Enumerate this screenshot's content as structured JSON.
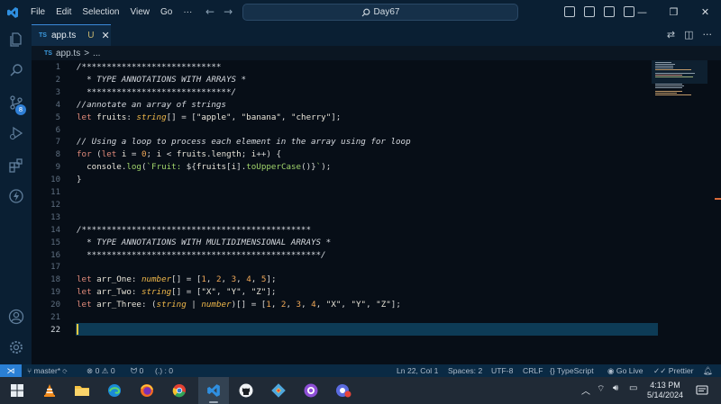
{
  "titlebar": {
    "menu": [
      "File",
      "Edit",
      "Selection",
      "View",
      "Go",
      "···"
    ],
    "search_text": "Day67"
  },
  "activity": {
    "scm_badge": "8"
  },
  "tab": {
    "lang": "TS",
    "name": "app.ts",
    "status": "U"
  },
  "breadcrumb": {
    "lang": "TS",
    "file": "app.ts",
    "sep": ">",
    "rest": "..."
  },
  "editor": {
    "active_line": 22,
    "lines": [
      [
        [
          "c-com",
          "/****************************"
        ]
      ],
      [
        [
          "c-com",
          "  * TYPE ANNOTATIONS WITH ARRAYS *"
        ]
      ],
      [
        [
          "c-com",
          "  *****************************/"
        ]
      ],
      [
        [
          "c-com",
          "//annotate an array of strings"
        ]
      ],
      [
        [
          "c-kw",
          "let "
        ],
        [
          "c-id",
          "fruits"
        ],
        [
          "c-pun",
          ": "
        ],
        [
          "c-ty",
          "string"
        ],
        [
          "c-pun",
          "[] = ["
        ],
        [
          "c-str",
          "\"apple\""
        ],
        [
          "c-pun",
          ", "
        ],
        [
          "c-str",
          "\"banana\""
        ],
        [
          "c-pun",
          ", "
        ],
        [
          "c-str",
          "\"cherry\""
        ],
        [
          "c-pun",
          "];"
        ]
      ],
      [],
      [
        [
          "c-com",
          "// Using a loop to process each element in the array using for loop"
        ]
      ],
      [
        [
          "c-kw",
          "for "
        ],
        [
          "c-pun",
          "("
        ],
        [
          "c-kw",
          "let "
        ],
        [
          "c-id",
          "i"
        ],
        [
          "c-pun",
          " = "
        ],
        [
          "c-num",
          "0"
        ],
        [
          "c-pun",
          "; "
        ],
        [
          "c-id",
          "i"
        ],
        [
          "c-pun",
          " < "
        ],
        [
          "c-id",
          "fruits"
        ],
        [
          "c-pun",
          "."
        ],
        [
          "c-id",
          "length"
        ],
        [
          "c-pun",
          "; "
        ],
        [
          "c-id",
          "i"
        ],
        [
          "c-pun",
          "++) {"
        ]
      ],
      [
        [
          "c-pun",
          "  "
        ],
        [
          "c-id",
          "console"
        ],
        [
          "c-pun",
          "."
        ],
        [
          "c-fn",
          "log"
        ],
        [
          "c-pun",
          "("
        ],
        [
          "c-tpl",
          "`Fruit: "
        ],
        [
          "c-pun",
          "${"
        ],
        [
          "c-id",
          "fruits"
        ],
        [
          "c-pun",
          "["
        ],
        [
          "c-id",
          "i"
        ],
        [
          "c-pun",
          "]."
        ],
        [
          "c-fn",
          "toUpperCase"
        ],
        [
          "c-pun",
          "()}"
        ],
        [
          "c-tpl",
          "`"
        ],
        [
          "c-pun",
          ");"
        ]
      ],
      [
        [
          "c-pun",
          "}"
        ]
      ],
      [],
      [],
      [],
      [
        [
          "c-com",
          "/**********************************************"
        ]
      ],
      [
        [
          "c-com",
          "  * TYPE ANNOTATIONS WITH MULTIDIMENSIONAL ARRAYS *"
        ]
      ],
      [
        [
          "c-com",
          "  ***********************************************/"
        ]
      ],
      [],
      [
        [
          "c-kw",
          "let "
        ],
        [
          "c-id",
          "arr_One"
        ],
        [
          "c-pun",
          ": "
        ],
        [
          "c-ty",
          "number"
        ],
        [
          "c-pun",
          "[] = ["
        ],
        [
          "c-num",
          "1"
        ],
        [
          "c-pun",
          ", "
        ],
        [
          "c-num",
          "2"
        ],
        [
          "c-pun",
          ", "
        ],
        [
          "c-num",
          "3"
        ],
        [
          "c-pun",
          ", "
        ],
        [
          "c-num",
          "4"
        ],
        [
          "c-pun",
          ", "
        ],
        [
          "c-num",
          "5"
        ],
        [
          "c-pun",
          "];"
        ]
      ],
      [
        [
          "c-kw",
          "let "
        ],
        [
          "c-id",
          "arr_Two"
        ],
        [
          "c-pun",
          ": "
        ],
        [
          "c-ty",
          "string"
        ],
        [
          "c-pun",
          "[] = ["
        ],
        [
          "c-str",
          "\"X\""
        ],
        [
          "c-pun",
          ", "
        ],
        [
          "c-str",
          "\"Y\""
        ],
        [
          "c-pun",
          ", "
        ],
        [
          "c-str",
          "\"Z\""
        ],
        [
          "c-pun",
          "];"
        ]
      ],
      [
        [
          "c-kw",
          "let "
        ],
        [
          "c-id",
          "arr_Three"
        ],
        [
          "c-pun",
          ": ("
        ],
        [
          "c-ty",
          "string"
        ],
        [
          "c-pun",
          " | "
        ],
        [
          "c-ty",
          "number"
        ],
        [
          "c-pun",
          ")[] = ["
        ],
        [
          "c-num",
          "1"
        ],
        [
          "c-pun",
          ", "
        ],
        [
          "c-num",
          "2"
        ],
        [
          "c-pun",
          ", "
        ],
        [
          "c-num",
          "3"
        ],
        [
          "c-pun",
          ", "
        ],
        [
          "c-num",
          "4"
        ],
        [
          "c-pun",
          ", "
        ],
        [
          "c-str",
          "\"X\""
        ],
        [
          "c-pun",
          ", "
        ],
        [
          "c-str",
          "\"Y\""
        ],
        [
          "c-pun",
          ", "
        ],
        [
          "c-str",
          "\"Z\""
        ],
        [
          "c-pun",
          "];"
        ]
      ],
      [],
      []
    ]
  },
  "statusbar": {
    "branch": "master*",
    "errors": "0",
    "warnings": "0",
    "ports": "0",
    "selection": "(.) : 0",
    "position": "Ln 22, Col 1",
    "spaces": "Spaces: 2",
    "encoding": "UTF-8",
    "eol": "CRLF",
    "language": "TypeScript",
    "golive": "Go Live",
    "prettier": "Prettier"
  },
  "taskbar": {
    "time": "4:13 PM",
    "date": "5/14/2024"
  }
}
